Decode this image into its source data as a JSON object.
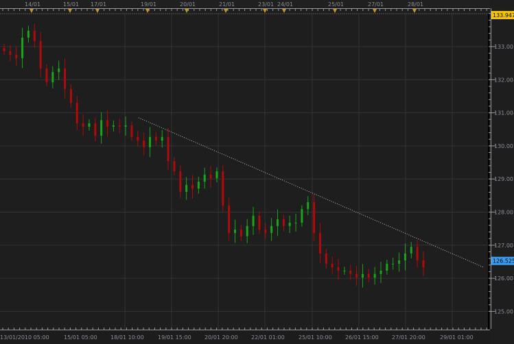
{
  "chart_data": {
    "type": "candlestick",
    "title": "",
    "xlabel": "",
    "ylabel": "",
    "ylim": [
      124.5,
      134.0
    ],
    "grid": true,
    "y_ticks": [
      "133.00",
      "132.00",
      "131.00",
      "130.00",
      "129.00",
      "128.00",
      "127.00",
      "126.00",
      "125.00"
    ],
    "y_tick_values": [
      133,
      132,
      131,
      130,
      129,
      128,
      127,
      126,
      125
    ],
    "x_tick_labels": [
      "13/01/2010 05:00",
      "15/01 05:00",
      "18/01 10:00",
      "19/01 15:00",
      "20/01 20:00",
      "22/01 01:00",
      "25/01 10:00",
      "26/01 15:00",
      "27/01 20:00",
      "29/01 01:00"
    ],
    "top_date_markers": [
      "14/01",
      "15/01",
      "17/01",
      "19/01",
      "20/01",
      "21/01",
      "23/01",
      "24/01",
      "25/01",
      "27/01",
      "28/01"
    ],
    "high_label": "133.947",
    "last_price_label": "126.525",
    "last_price": 126.525,
    "high_price": 133.947,
    "closes": [
      132.86,
      132.75,
      132.65,
      133.27,
      133.48,
      133.17,
      132.34,
      131.92,
      132.23,
      132.34,
      131.72,
      131.3,
      130.68,
      130.58,
      130.68,
      130.31,
      130.78,
      130.58,
      130.62,
      130.58,
      130.62,
      130.27,
      130.16,
      129.96,
      130.27,
      130.16,
      130.27,
      129.54,
      129.23,
      128.61,
      128.82,
      128.71,
      128.92,
      129.13,
      129.02,
      129.23,
      128.2,
      127.37,
      127.47,
      127.27,
      127.58,
      127.89,
      127.47,
      127.37,
      127.58,
      127.78,
      127.58,
      127.68,
      127.68,
      128.09,
      128.3,
      127.37,
      126.75,
      126.44,
      126.33,
      126.23,
      126.23,
      126.13,
      126.02,
      126.13,
      126.02,
      126.13,
      126.23,
      126.44,
      126.44,
      126.54,
      126.75,
      126.95,
      126.54,
      126.33
    ],
    "trendline": {
      "start_price": 130.85,
      "end_price": 126.33,
      "style": "dotted"
    },
    "colors": {
      "up": "#19a619",
      "down": "#b00a0a",
      "background": "#1e1e1e",
      "grid": "#333333",
      "high_badge": "#f5c400",
      "last_badge": "#3a9cf0",
      "marker": "#c8961e"
    }
  }
}
